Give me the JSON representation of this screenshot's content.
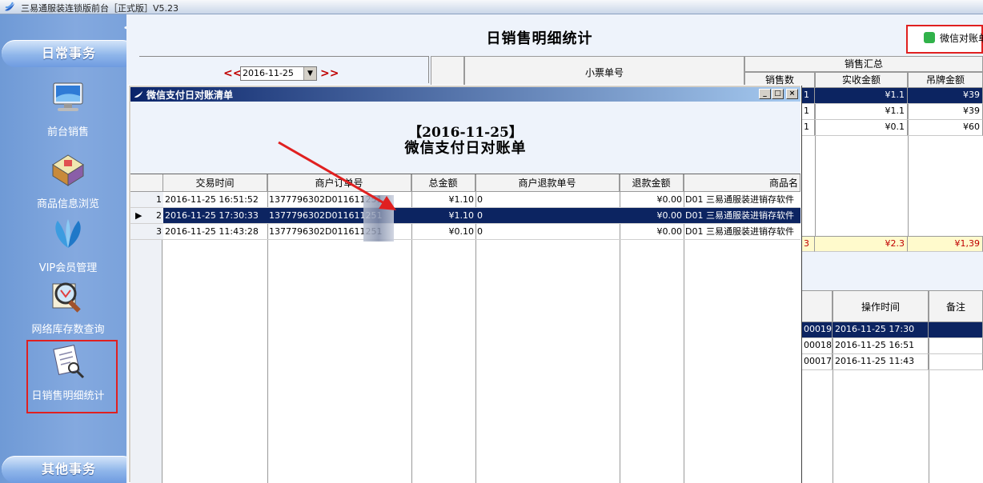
{
  "app": {
    "title": "三易通服装连锁版前台［正式版］V5.23"
  },
  "sidebar": {
    "collapse": "<<",
    "group1": "日常事务",
    "items": [
      {
        "label": "前台销售",
        "icon": "monitor-icon"
      },
      {
        "label": "商品信息浏览",
        "icon": "boxes-icon"
      },
      {
        "label": "VIP会员管理",
        "icon": "vip-icon"
      },
      {
        "label": "网络库存数查询",
        "icon": "magnifier-icon"
      },
      {
        "label": "日销售明细统计",
        "icon": "report-icon"
      }
    ],
    "group2": "其他事务"
  },
  "page": {
    "title": "日销售明细统计",
    "wechat_button": "微信对账单",
    "date_prev": "<<",
    "date_next": ">>",
    "date_value": "2016-11-25"
  },
  "summary_grid": {
    "col_ticket": "小票单号",
    "group_header": "销售汇总",
    "col_qty": "销售数",
    "col_paid": "实收金额",
    "col_tag": "吊牌金额",
    "rows": [
      {
        "qty": "1",
        "paid": "¥1.1",
        "tag": "¥39"
      },
      {
        "qty": "1",
        "paid": "¥1.1",
        "tag": "¥39"
      },
      {
        "qty": "1",
        "paid": "¥0.1",
        "tag": "¥60"
      }
    ],
    "total": {
      "qty": "3",
      "paid": "¥2.3",
      "tag": "¥1,39"
    }
  },
  "detail_grid": {
    "col_optime": "操作时间",
    "col_note": "备注",
    "rows": [
      {
        "id": "00019",
        "time": "2016-11-25 17:30"
      },
      {
        "id": "00018",
        "time": "2016-11-25 16:51"
      },
      {
        "id": "00017",
        "time": "2016-11-25 11:43"
      }
    ]
  },
  "dialog": {
    "title": "微信支付日对账清单",
    "date_heading": "【2016-11-25】",
    "subtitle": "微信支付日对账单",
    "columns": [
      "交易时间",
      "商户订单号",
      "总金额",
      "商户退款单号",
      "退款金额",
      "商品名"
    ],
    "rows": [
      {
        "no": "1",
        "time": "2016-11-25 16:51:52",
        "order": "1377796302D011611251",
        "total": "¥1.10",
        "refund_no": "0",
        "refund": "¥0.00",
        "product": "D01 三易通服装进销存软件"
      },
      {
        "no": "2",
        "time": "2016-11-25 17:30:33",
        "order": "1377796302D011611251",
        "total": "¥1.10",
        "refund_no": "0",
        "refund": "¥0.00",
        "product": "D01 三易通服装进销存软件"
      },
      {
        "no": "3",
        "time": "2016-11-25 11:43:28",
        "order": "1377796302D011611251",
        "total": "¥0.10",
        "refund_no": "0",
        "refund": "¥0.00",
        "product": "D01 三易通服装进销存软件"
      }
    ],
    "selected_row": 2
  },
  "colors": {
    "selection": "#0c2461",
    "highlight_red": "#e02020",
    "wechat_green": "#31b24a"
  }
}
